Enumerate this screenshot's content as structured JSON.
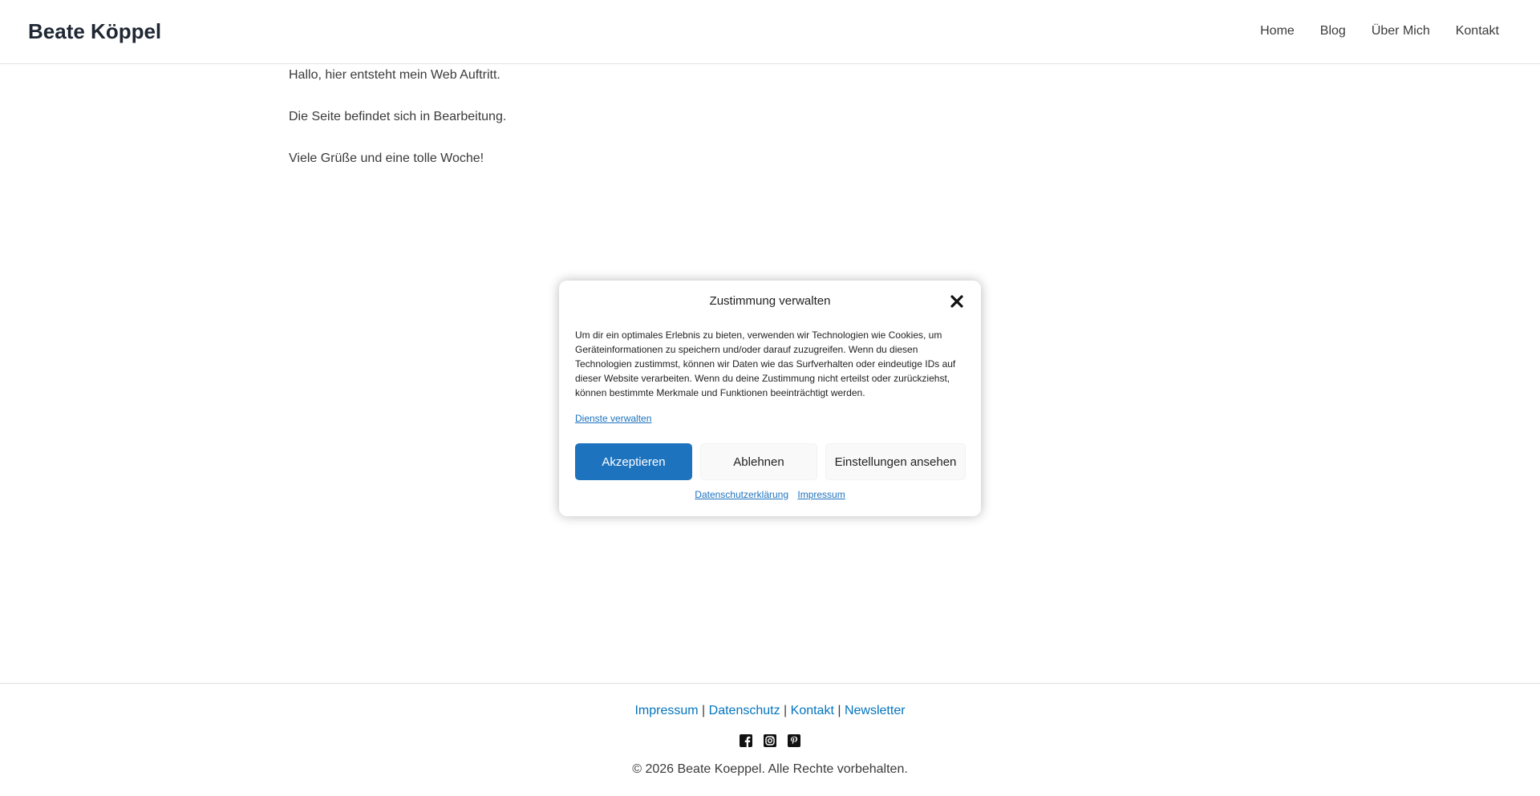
{
  "header": {
    "site_title": "Beate Köppel",
    "nav": [
      {
        "label": "Home"
      },
      {
        "label": "Blog"
      },
      {
        "label": "Über Mich"
      },
      {
        "label": "Kontakt"
      }
    ]
  },
  "content": {
    "paragraphs": [
      "Hallo, hier entsteht mein Web Auftritt.",
      "Die Seite befindet sich in Bearbeitung.",
      "Viele Grüße und eine tolle Woche!"
    ]
  },
  "cookie_modal": {
    "title": "Zustimmung verwalten",
    "close_icon": "close-icon",
    "body": "Um dir ein optimales Erlebnis zu bieten, verwenden wir Technologien wie Cookies, um Geräteinformationen zu speichern und/oder darauf zuzugreifen. Wenn du diesen Technologien zustimmst, können wir Daten wie das Surfverhalten oder eindeutige IDs auf dieser Website verarbeiten. Wenn du deine Zustimmung nicht erteilst oder zurückziehst, können bestimmte Merkmale und Funktionen beeinträchtigt werden.",
    "manage_services_link": "Dienste verwalten",
    "accept_label": "Akzeptieren",
    "deny_label": "Ablehnen",
    "settings_label": "Einstellungen ansehen",
    "privacy_link": "Datenschutzerklärung",
    "imprint_link": "Impressum",
    "accent_color": "#1e73be"
  },
  "footer": {
    "links": [
      {
        "label": "Impressum"
      },
      {
        "label": "Datenschutz"
      },
      {
        "label": "Kontakt"
      },
      {
        "label": "Newsletter"
      }
    ],
    "separator": "|",
    "social_icons": [
      "facebook-icon",
      "instagram-icon",
      "pinterest-icon"
    ],
    "copyright": "© 2026 Beate Koeppel. Alle Rechte vorbehalten.",
    "link_color": "#0274be"
  }
}
